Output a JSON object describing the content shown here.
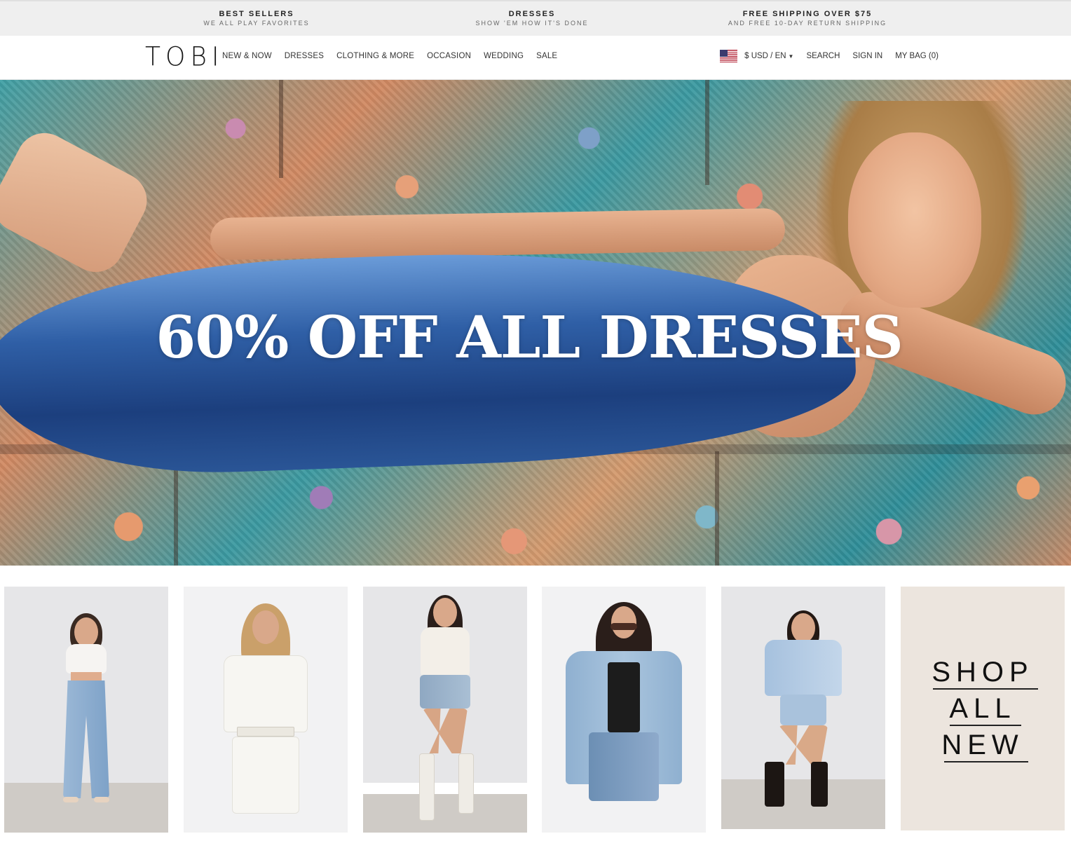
{
  "promo_bar": [
    {
      "title": "BEST SELLERS",
      "subtitle": "WE ALL PLAY FAVORITES"
    },
    {
      "title": "DRESSES",
      "subtitle": "SHOW 'EM HOW IT'S DONE"
    },
    {
      "title": "FREE SHIPPING OVER $75",
      "subtitle": "AND FREE 10-DAY RETURN SHIPPING"
    }
  ],
  "header": {
    "logo": "TOBI",
    "nav": [
      "NEW & NOW",
      "DRESSES",
      "CLOTHING & MORE",
      "OCCASION",
      "WEDDING",
      "SALE"
    ],
    "currency": "$ USD / EN",
    "currency_flag_icon": "us-flag-icon",
    "search": "SEARCH",
    "sign_in": "SIGN IN",
    "bag": "MY BAG (0)"
  },
  "hero": {
    "headline": "60% OFF ALL DRESSES"
  },
  "products": {
    "shop_all": [
      "SHOP",
      "ALL",
      "NEW"
    ]
  },
  "colors": {
    "promo_bg": "#efefef",
    "headline": "#ffffff",
    "shop_all_bg": "#ece5de",
    "dress": "#2f5fa6"
  }
}
